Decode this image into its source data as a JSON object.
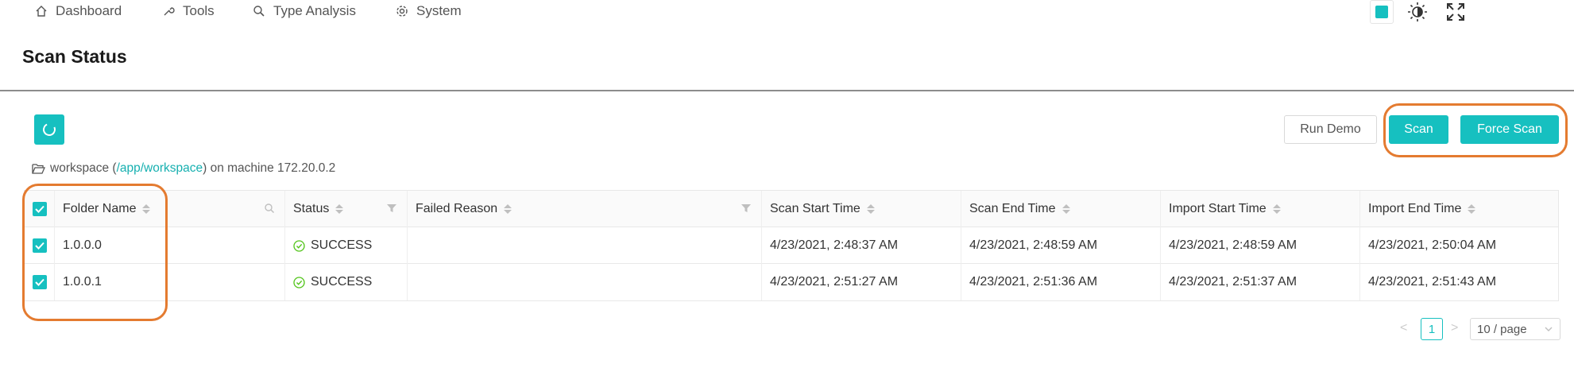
{
  "nav": {
    "items": [
      {
        "label": "Dashboard",
        "icon": "home-icon"
      },
      {
        "label": "Tools",
        "icon": "wrench-icon"
      },
      {
        "label": "Type Analysis",
        "icon": "search-icon"
      },
      {
        "label": "System",
        "icon": "gear-icon"
      }
    ]
  },
  "header": {
    "title": "Scan Status"
  },
  "toolbar": {
    "run_demo_label": "Run Demo",
    "scan_label": "Scan",
    "force_scan_label": "Force Scan"
  },
  "workspace": {
    "prefix": "workspace (",
    "path": "/app/workspace",
    "suffix": ") on machine 172.20.0.2"
  },
  "table": {
    "columns": [
      "Folder Name",
      "Status",
      "Failed Reason",
      "Scan Start Time",
      "Scan End Time",
      "Import Start Time",
      "Import End Time"
    ],
    "rows": [
      {
        "checked": true,
        "folder": "1.0.0.0",
        "status": "SUCCESS",
        "reason": "",
        "scan_start": "4/23/2021, 2:48:37 AM",
        "scan_end": "4/23/2021, 2:48:59 AM",
        "import_start": "4/23/2021, 2:48:59 AM",
        "import_end": "4/23/2021, 2:50:04 AM"
      },
      {
        "checked": true,
        "folder": "1.0.0.1",
        "status": "SUCCESS",
        "reason": "",
        "scan_start": "4/23/2021, 2:51:27 AM",
        "scan_end": "4/23/2021, 2:51:36 AM",
        "import_start": "4/23/2021, 2:51:37 AM",
        "import_end": "4/23/2021, 2:51:43 AM"
      }
    ]
  },
  "pagination": {
    "prev": "<",
    "current": "1",
    "next": ">",
    "page_size": "10 / page"
  },
  "colors": {
    "accent": "#16c0c0",
    "highlight": "#e47b30",
    "success": "#52c41a"
  }
}
